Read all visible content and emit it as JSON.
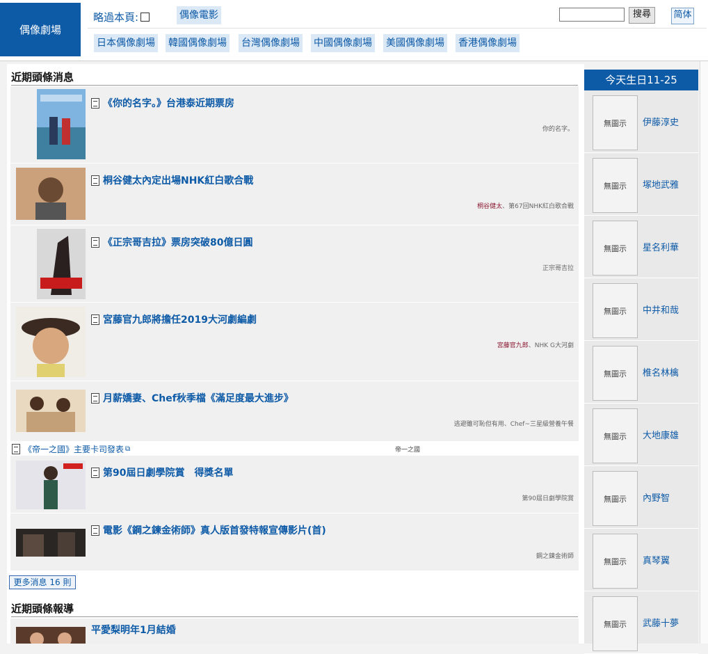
{
  "header": {
    "logo": "偶像劇場",
    "skip_label": "略過本頁:",
    "movies_tab": "偶像電影",
    "search_button": "搜尋",
    "search_value": "",
    "simplified_button": "简体",
    "categories": [
      "日本偶像劇場",
      "韓國偶像劇場",
      "台灣偶像劇場",
      "中國偶像劇場",
      "美國偶像劇場",
      "香港偶像劇場"
    ]
  },
  "news": {
    "section_title": "近期頭條消息",
    "items": [
      {
        "title": "《你的名字。》台港泰近期票房",
        "tags": [
          {
            "text": "你的名字。",
            "kind": "g"
          }
        ]
      },
      {
        "title": "桐谷健太內定出場NHK紅白歌合戰",
        "tags": [
          {
            "text": "桐谷健太",
            "kind": "p"
          },
          {
            "text": "、第67回NHK紅白歌合戰",
            "kind": "g"
          }
        ]
      },
      {
        "title": "《正宗哥吉拉》票房突破80億日圓",
        "tags": [
          {
            "text": "正宗哥吉拉",
            "kind": "g"
          }
        ]
      },
      {
        "title": "宮藤官九郎將擔任2019大河劇編劇",
        "tags": [
          {
            "text": "宮藤官九郎",
            "kind": "p"
          },
          {
            "text": "、NHK G大河劇",
            "kind": "g"
          }
        ]
      },
      {
        "title": "月薪嬌妻、Chef秋季檔《滿足度最大進步》",
        "tags": [
          {
            "text": "逃避雖可恥但有用",
            "kind": "g"
          },
          {
            "text": "、Chef~三星級營養午餐",
            "kind": "g"
          }
        ]
      },
      {
        "title": "第90屆日劇學院賞　得獎名單",
        "tags": [
          {
            "text": "第90屆日劇學院賞",
            "kind": "g"
          }
        ]
      },
      {
        "title": "電影《鋼之鍊金術師》真人版首發特報宣傳影片(首)",
        "tags": [
          {
            "text": "鋼之鍊金術師",
            "kind": "g"
          }
        ]
      }
    ],
    "inline_item": {
      "title": "《帝一之國》主要卡司發表",
      "tag": "帝一之國"
    },
    "more_button": "更多消息 16 則"
  },
  "reports": {
    "section_title": "近期頭條報導",
    "items": [
      {
        "title": "平愛梨明年1月結婚"
      }
    ]
  },
  "birthday": {
    "title": "今天生日11-25",
    "no_image": "無圖示",
    "people": [
      "伊藤淳史",
      "塚地武雅",
      "星名利華",
      "中井和哉",
      "椎名林檎",
      "大地康雄",
      "內野智",
      "真琴翼",
      "武藤十夢"
    ]
  },
  "colors": {
    "brand": "#0d5aa7",
    "tag_person": "#8b1a32"
  }
}
